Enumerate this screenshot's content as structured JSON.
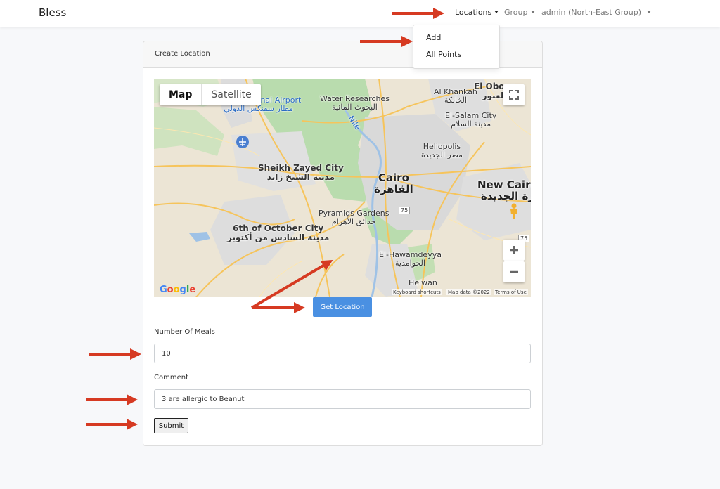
{
  "navbar": {
    "brand": "Bless",
    "links": [
      {
        "label": "Locations",
        "active": true
      },
      {
        "label": "Group",
        "active": false
      },
      {
        "label": "admin (North-East Group)",
        "active": false
      }
    ],
    "dropdown": [
      "Add",
      "All Points"
    ]
  },
  "card": {
    "title": "Create Location"
  },
  "map": {
    "type_buttons": [
      "Map",
      "Satellite"
    ],
    "labels": {
      "cairo_en": "Cairo",
      "cairo_ar": "القاهرة",
      "new_cairo_en": "New Cairo City",
      "new_cairo_ar": "القاهرة الجديدة",
      "sheikh_en": "Sheikh Zayed City",
      "sheikh_ar": "مدينة الشيخ زايد",
      "october_en": "6th of October City",
      "october_ar": "مدينة السادس من أكتوبر",
      "pyramids_en": "Pyramids Gardens",
      "pyramids_ar": "حدائق الأهرام",
      "heliopolis_en": "Heliopolis",
      "heliopolis_ar": "مصر الجديدة",
      "elsalam_en": "El-Salam City",
      "elsalam_ar": "مدينة السلام",
      "khankah_en": "Al Khankah",
      "khankah_ar": "الخانكة",
      "obour_en": "El Obour",
      "obour_ar": "العبور",
      "water_en": "Water Researches",
      "water_ar": "البحوث المائية",
      "airport_en": "x International Airport",
      "airport_ar": "مطار سفنكس الدولي",
      "nile": "Nile",
      "hawamdeyya_en": "El-Hawamdeyya",
      "hawamdeyya_ar": "الحوامدية",
      "helwan_en": "Helwan",
      "highway_75_a": "75",
      "highway_75_b": "75"
    },
    "footer": {
      "logo": "Google",
      "keyboard": "Keyboard shortcuts",
      "data": "Map data ©2022",
      "terms": "Terms of Use"
    },
    "colors": {
      "land": "#ece5d5",
      "green": "#b9dcae",
      "urban": "#d9d9d9",
      "road": "#f6c45b",
      "water": "#9fc2e6"
    }
  },
  "form": {
    "get_location": "Get Location",
    "meals_label": "Number Of Meals",
    "meals_value": "10",
    "comment_label": "Comment",
    "comment_value": "3 are allergic to Beanut",
    "submit": "Submit"
  },
  "annotation_color": "#d63a22"
}
